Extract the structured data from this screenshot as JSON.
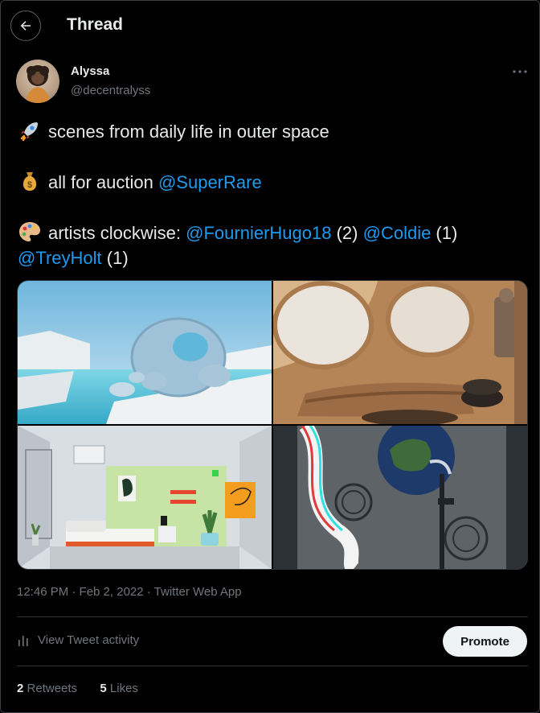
{
  "header": {
    "title": "Thread",
    "back_icon": "arrow-left-icon"
  },
  "author": {
    "name": "Alyssa",
    "handle": "@decentralyss"
  },
  "tweet": {
    "line1": {
      "emoji": "rocket",
      "text": "scenes from daily life in outer space"
    },
    "line2": {
      "emoji": "money-bag",
      "text": "all for auction ",
      "mention": "@SuperRare"
    },
    "line3": {
      "emoji": "artist-palette",
      "text": "artists clockwise: ",
      "mention1": "@FournierHugo18",
      "count1": " (2) ",
      "mention2": "@Coldie",
      "count2": " (1)",
      "mention3": "@TreyHolt",
      "count3": " (1)"
    }
  },
  "meta": {
    "timestamp": "12:46 PM · Feb 2, 2022 · Twitter Web App"
  },
  "activity": {
    "label": "View Tweet activity"
  },
  "promote": {
    "label": "Promote"
  },
  "stats": {
    "retweets_count": "2",
    "retweets_label": "Retweets",
    "likes_count": "5",
    "likes_label": "Likes"
  },
  "colors": {
    "background": "#000000",
    "text": "#e7e9ea",
    "muted": "#71767b",
    "link": "#1d9bf0",
    "divider": "#2f3336"
  }
}
